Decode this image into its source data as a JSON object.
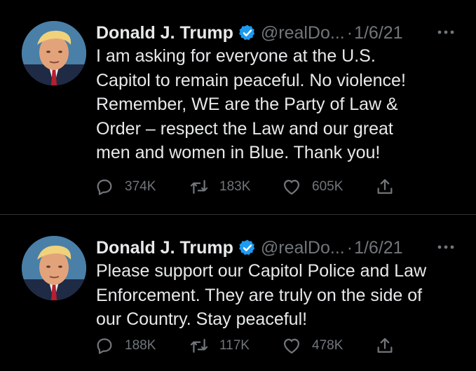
{
  "colors": {
    "background": "#000000",
    "text_primary": "#e7e9ea",
    "text_secondary": "#71767b",
    "verified_badge": "#1d9bf0",
    "divider": "#2f3336"
  },
  "tweets": [
    {
      "author_name": "Donald J. Trump",
      "verified_icon": "verified-badge-icon",
      "handle": "@realDo...",
      "separator": "·",
      "date": "1/6/21",
      "text": "I am asking for everyone at the U.S.\nCapitol to remain peaceful. No violence!\nRemember, WE are the Party of Law &\nOrder – respect the Law and our great\nmen and women in Blue. Thank you!",
      "replies": "374K",
      "retweets": "183K",
      "likes": "605K"
    },
    {
      "author_name": "Donald J. Trump",
      "verified_icon": "verified-badge-icon",
      "handle": "@realDo...",
      "separator": "·",
      "date": "1/6/21",
      "text": "Please support our Capitol Police and Law\nEnforcement. They are truly on the side of\nour Country. Stay peaceful!",
      "replies": "188K",
      "retweets": "117K",
      "likes": "478K"
    }
  ]
}
